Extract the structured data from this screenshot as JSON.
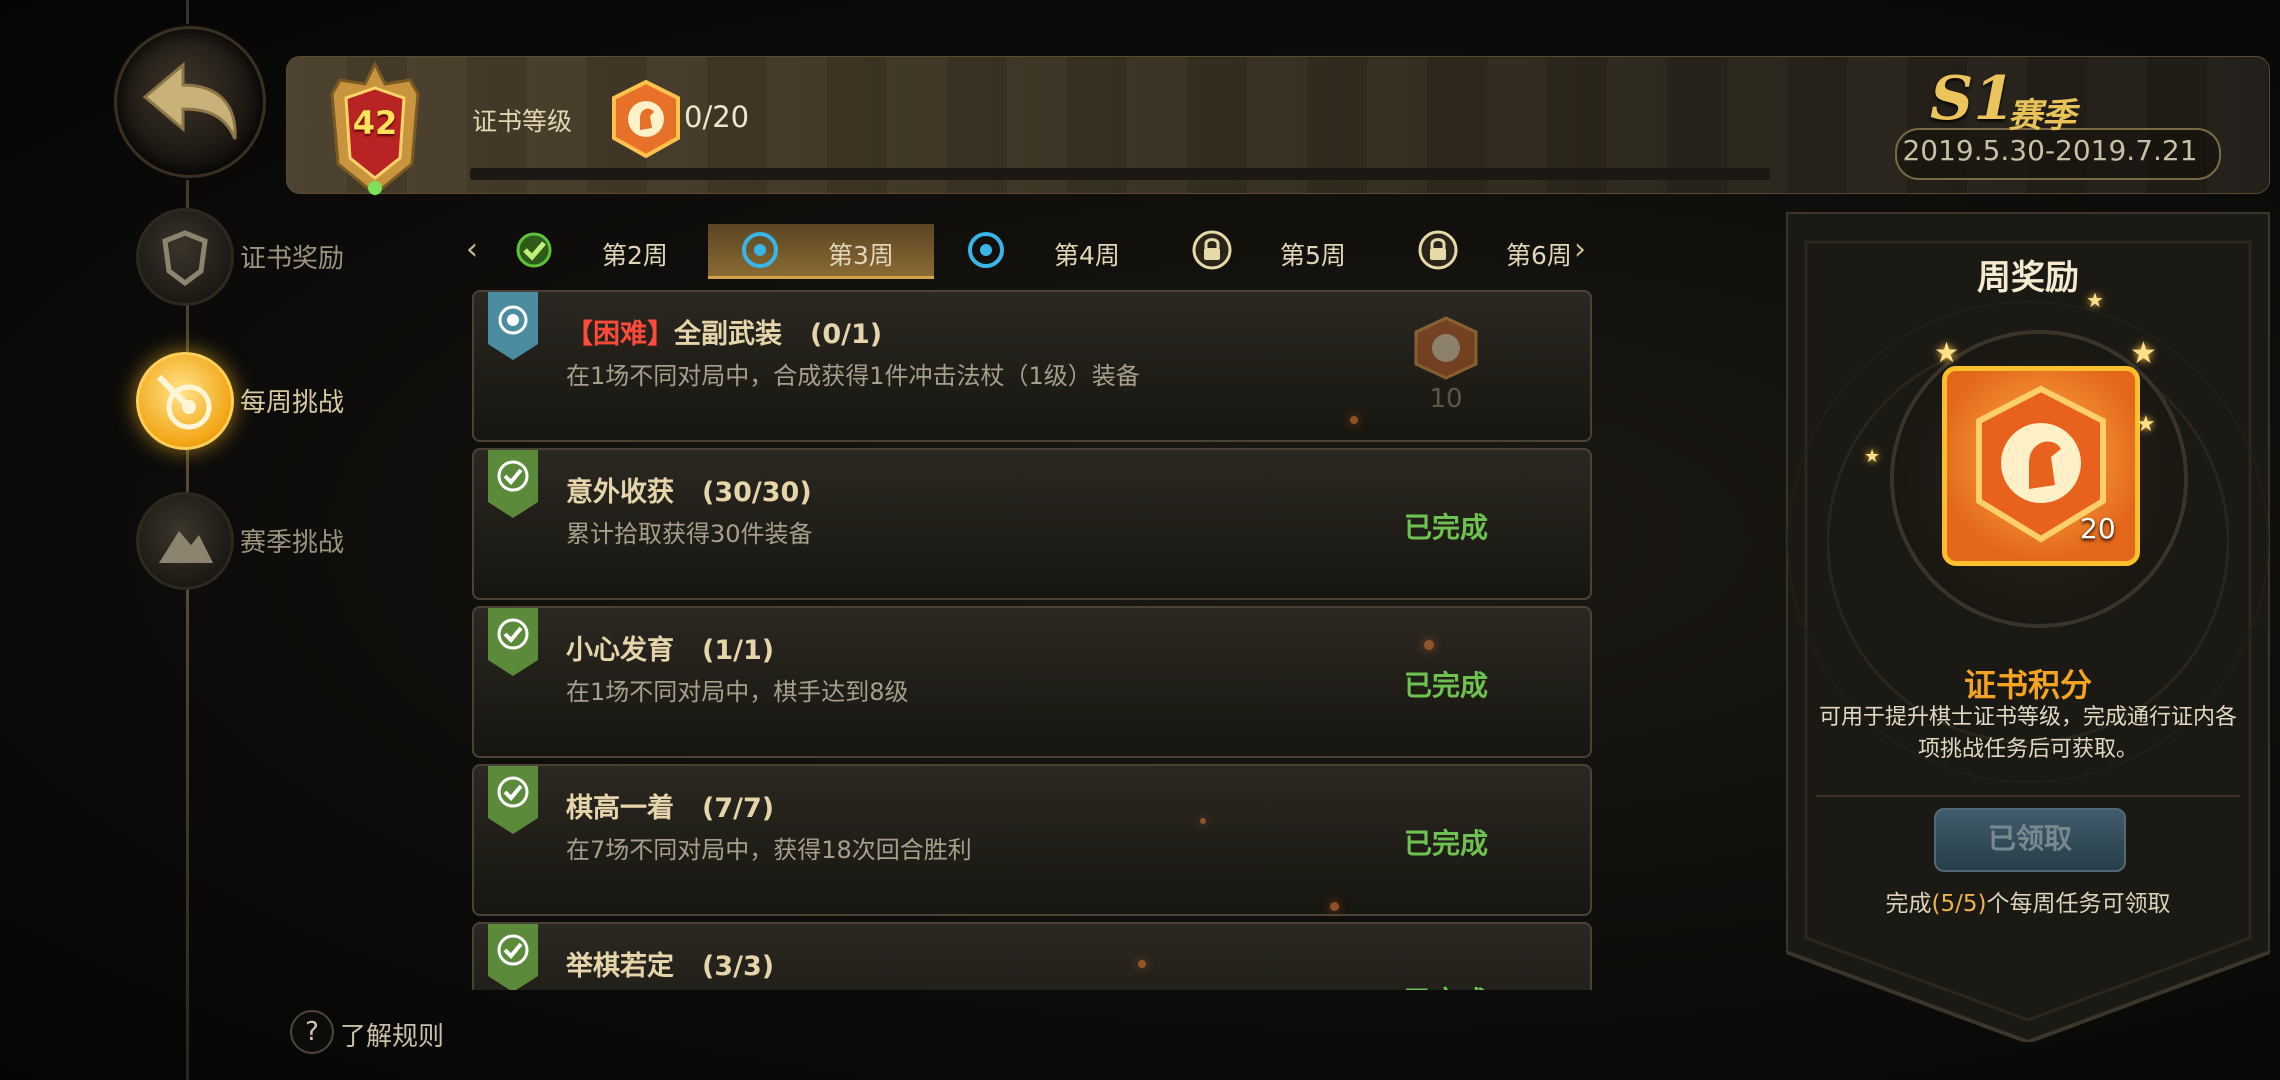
{
  "header": {
    "level": "42",
    "cert_label": "证书等级",
    "exp_text": "0/20",
    "exp_progress": 0,
    "season_code": "S1",
    "season_word": "赛季",
    "season_dates": "2019.5.30-2019.7.21"
  },
  "nav": [
    {
      "label": "证书奖励",
      "icon": "shield-icon",
      "active": false
    },
    {
      "label": "每周挑战",
      "icon": "target-arrow-icon",
      "active": true
    },
    {
      "label": "赛季挑战",
      "icon": "mountain-flag-icon",
      "active": false
    }
  ],
  "tabs": [
    {
      "label": "第2周",
      "icon": "check-icon",
      "state": "complete"
    },
    {
      "label": "第3周",
      "icon": "target-icon",
      "state": "active"
    },
    {
      "label": "第4周",
      "icon": "target-icon",
      "state": "open"
    },
    {
      "label": "第5周",
      "icon": "lock-icon",
      "state": "locked"
    },
    {
      "label": "第6周",
      "icon": "lock-icon",
      "state": "locked"
    }
  ],
  "tasks": [
    {
      "tag": "【困难】",
      "title": "全副武装",
      "progress": "(0/1)",
      "desc": "在1场不同对局中，合成获得1件冲击法杖（1级）装备",
      "status": "",
      "reward": "10",
      "flag": "target-flag-icon"
    },
    {
      "tag": "",
      "title": "意外收获",
      "progress": "(30/30)",
      "desc": "累计拾取获得30件装备",
      "status": "已完成",
      "reward": "",
      "flag": "check-flag-icon"
    },
    {
      "tag": "",
      "title": "小心发育",
      "progress": "(1/1)",
      "desc": "在1场不同对局中，棋手达到8级",
      "status": "已完成",
      "reward": "",
      "flag": "check-flag-icon"
    },
    {
      "tag": "",
      "title": "棋高一着",
      "progress": "(7/7)",
      "desc": "在7场不同对局中，获得18次回合胜利",
      "status": "已完成",
      "reward": "",
      "flag": "check-flag-icon"
    },
    {
      "tag": "",
      "title": "举棋若定",
      "progress": "(3/3)",
      "desc": "",
      "status": "已完成",
      "reward": "",
      "flag": "check-flag-icon"
    }
  ],
  "rules_label": "了解规则",
  "weekly": {
    "title": "周奖励",
    "medal_count": "20",
    "points_title": "证书积分",
    "points_desc": "可用于提升棋士证书等级，完成通行证内各项挑战任务后可获取。",
    "claim_label": "已领取",
    "claim_note_prefix": "完成",
    "claim_note_count": "(5/5)",
    "claim_note_suffix": "个每周任务可领取"
  },
  "colors": {
    "accent": "#d3a445",
    "done": "#6ec24f",
    "hard": "#ff4a3a",
    "points": "#f5a422"
  }
}
